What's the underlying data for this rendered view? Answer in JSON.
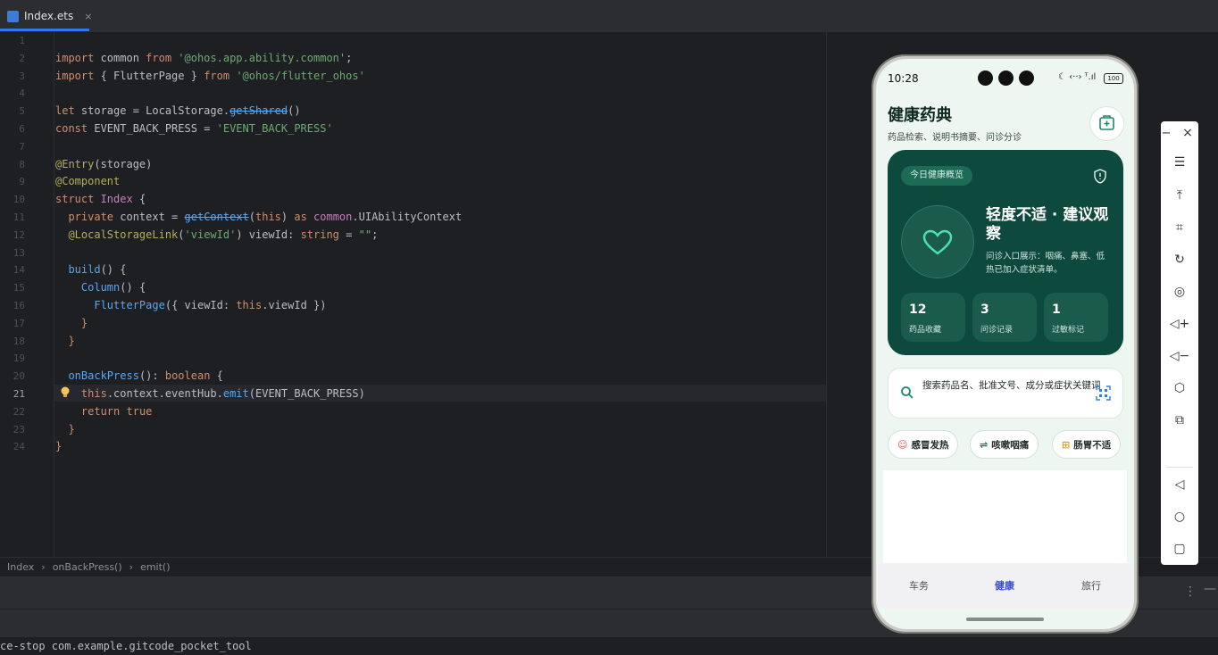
{
  "tab": {
    "filename": "Index.ets",
    "close": "×"
  },
  "code_lines": {
    "l2": {
      "kw1": "import",
      "p1": " common ",
      "kw2": "from",
      "s": " '@ohos.app.ability.common'",
      "p2": ";"
    },
    "l3": {
      "kw1": "import",
      "p1": " { FlutterPage } ",
      "kw2": "from",
      "s": " '@ohos/flutter_ohos'"
    },
    "l5": {
      "kw": "let",
      "p1": " storage = LocalStorage.",
      "fn": "getShared",
      "p2": "()"
    },
    "l6": {
      "kw": "const",
      "p1": " EVENT_BACK_PRESS = ",
      "s": "'EVENT_BACK_PRESS'"
    },
    "l8": {
      "ann": "@Entry",
      "p": "(storage)"
    },
    "l9": {
      "ann": "@Component"
    },
    "l10": {
      "kw": "struct",
      "ty": " Index",
      "p": " {"
    },
    "l11": {
      "kw": "private",
      "p1": " context = ",
      "fn": "getContext",
      "p2": "(",
      "kw2": "this",
      "p3": ") ",
      "kw3": "as",
      "ty": " common",
      "p4": ".UIAbilityContext"
    },
    "l12": {
      "ann": "@LocalStorageLink",
      "p1": "(",
      "s": "'viewId'",
      "p2": ") viewId: ",
      "kw": "string",
      "p3": " = ",
      "s2": "\"\"",
      "p4": ";"
    },
    "l14": {
      "fn": "build",
      "p": "() {"
    },
    "l15": {
      "fn": "Column",
      "p": "() {"
    },
    "l16": {
      "fn": "FlutterPage",
      "p1": "({ viewId: ",
      "kw": "this",
      "p2": ".viewId })"
    },
    "l17": {
      "p": "}"
    },
    "l18": {
      "p": "}"
    },
    "l20": {
      "fn": "onBackPress",
      "p1": "(): ",
      "kw": "boolean",
      "p2": " {"
    },
    "l21": {
      "kw": "this",
      "p1": ".context.eventHub.",
      "fn": "emit",
      "p2": "(EVENT_BACK_PRESS)"
    },
    "l22": {
      "kw": "return",
      "kw2": " true"
    },
    "l23": {
      "p": "}"
    },
    "l24": {
      "p": "}"
    }
  },
  "line_numbers": [
    "1",
    "2",
    "3",
    "4",
    "5",
    "6",
    "7",
    "8",
    "9",
    "10",
    "11",
    "12",
    "13",
    "14",
    "15",
    "16",
    "17",
    "18",
    "19",
    "20",
    "21",
    "22",
    "23",
    "24"
  ],
  "breadcrumb": [
    "Index",
    "onBackPress()",
    "emit()"
  ],
  "console": {
    "text": "ce-stop com.example.gitcode_pocket_tool"
  },
  "phone": {
    "time": "10:28",
    "status_icons": "☾ ‹··› ᵀ.ıl",
    "battery": "100",
    "title": "健康药典",
    "subtitle": "药品检索、说明书摘要、问诊分诊",
    "card": {
      "pill": "今日健康概览",
      "status": "轻度不适 · 建议观察",
      "desc": "问诊入口展示：咽痛、鼻塞、低热已加入症状清单。",
      "stats": [
        {
          "num": "12",
          "label": "药品收藏"
        },
        {
          "num": "3",
          "label": "问诊记录"
        },
        {
          "num": "1",
          "label": "过敏标记"
        }
      ]
    },
    "search_placeholder": "搜索药品名、批准文号、成分或症状关键词",
    "chips": [
      {
        "icon": "☺",
        "label": "感冒发热",
        "color": "#e0524f"
      },
      {
        "icon": "⇌",
        "label": "咳嗽咽痛",
        "color": "#1f7a5f"
      },
      {
        "icon": "⊞",
        "label": "肠胃不适",
        "color": "#e39a1d"
      }
    ],
    "nav": [
      "车务",
      "健康",
      "旅行"
    ],
    "colors": {
      "card_bg": "#0d4a3d",
      "accent": "#1f8a6a",
      "nav_active": "#3b4bd1"
    }
  },
  "toolbar": {
    "min": "−",
    "close": "×"
  }
}
